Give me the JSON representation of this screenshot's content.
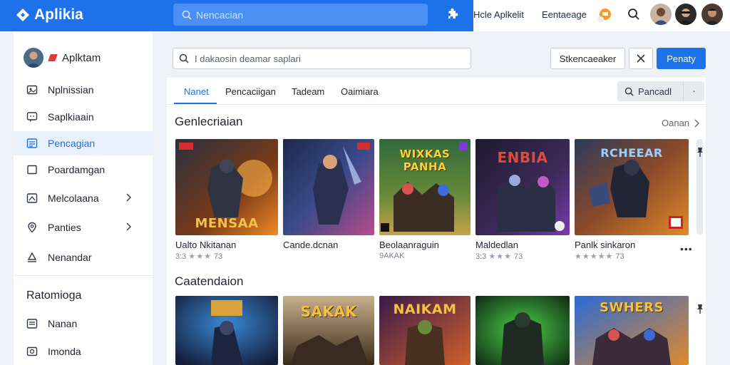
{
  "app": {
    "title": "Aplikia",
    "search_placeholder": "Nencacian",
    "top_links": [
      "Hcle Aplkelit",
      "Eentaeage"
    ]
  },
  "sidebar": {
    "user_label": "Aplktam",
    "items": [
      {
        "label": "Nplnissian",
        "icon": "image-icon",
        "active": false,
        "chevron": false
      },
      {
        "label": "Saplkiaain",
        "icon": "chat-icon",
        "active": false,
        "chevron": false
      },
      {
        "label": "Pencagian",
        "icon": "list-icon",
        "active": true,
        "chevron": false
      },
      {
        "label": "Poardamgan",
        "icon": "square-icon",
        "active": false,
        "chevron": false
      },
      {
        "label": "Melcolaana",
        "icon": "chart-icon",
        "active": false,
        "chevron": true
      },
      {
        "label": "Panties",
        "icon": "pin-icon",
        "active": false,
        "chevron": true
      },
      {
        "label": "Nenandar",
        "icon": "user-icon",
        "active": false,
        "chevron": false
      }
    ],
    "section_heading": "Ratomioga",
    "section_items": [
      {
        "label": "Nanan",
        "icon": "list-icon"
      },
      {
        "label": "Imonda",
        "icon": "image-icon"
      }
    ]
  },
  "main": {
    "search_placeholder": "I dakaosin deamar saplari",
    "filter_label": "Stkencaeaker",
    "primary_label": "Penaty",
    "tabs": [
      "Nanet",
      "Pencaciigan",
      "Tadeam",
      "Oaimiara"
    ],
    "sort_label": "Pancadl",
    "sort_more": "·"
  },
  "section1": {
    "title": "Genlecriaian",
    "see_all": "Oanan",
    "cards": [
      {
        "title_art": "MENSAA",
        "name": "Ualto Nkitanan",
        "meta": "3:3",
        "stars": "★★★",
        "rating": "73"
      },
      {
        "title_art": "",
        "name": "Cande.dcnan",
        "meta": "",
        "stars": "",
        "rating": ""
      },
      {
        "title_art": "WIXKAS PANHA",
        "name": "Beolaanraguin",
        "meta": "9AKAK",
        "stars": "",
        "rating": ""
      },
      {
        "title_art": "ENBIA",
        "name": "Maldedlan",
        "meta": "3:3",
        "stars": "★★★",
        "rating": "73"
      },
      {
        "title_art": "RCHEEAR",
        "name": "Panlk sinkaron",
        "meta": "",
        "stars": "★★★★★",
        "rating": "73"
      }
    ]
  },
  "section2": {
    "title": "Caatendaion",
    "cards": [
      {
        "title_art": ""
      },
      {
        "title_art": "SAKAK"
      },
      {
        "title_art": "NAIKAM"
      },
      {
        "title_art": ""
      },
      {
        "title_art": "SWHERS"
      }
    ]
  },
  "colors": {
    "accent": "#1d72ea",
    "topbar": "#1d72ea",
    "sidebar_active": "#e9f1fc"
  }
}
